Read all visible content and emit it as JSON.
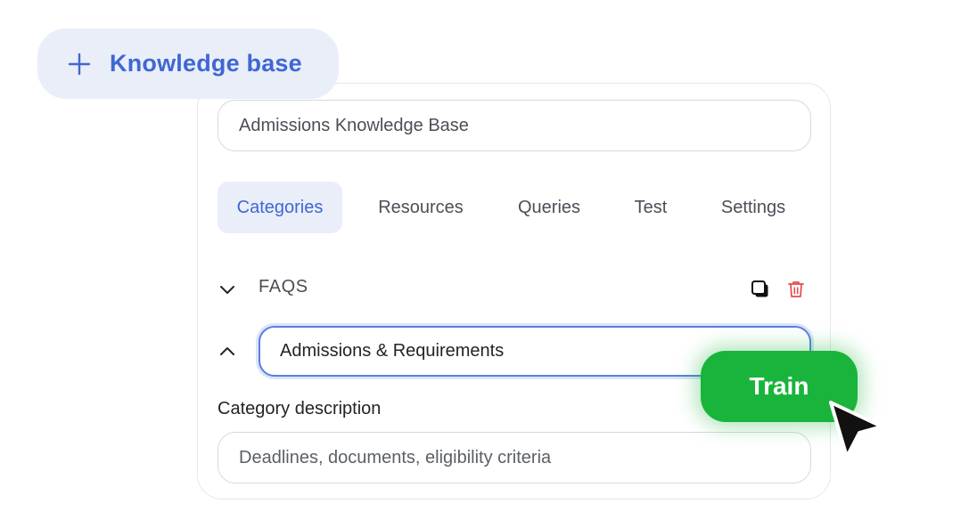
{
  "knowledge_base_button": {
    "label": "Knowledge base",
    "icon": "plus-icon"
  },
  "name_field": {
    "value": "Admissions Knowledge Base"
  },
  "tabs": [
    {
      "label": "Categories",
      "active": true
    },
    {
      "label": "Resources",
      "active": false
    },
    {
      "label": "Queries",
      "active": false
    },
    {
      "label": "Test",
      "active": false
    },
    {
      "label": "Settings",
      "active": false
    }
  ],
  "categories": [
    {
      "label": "FAQS",
      "expanded": false,
      "icons": [
        "copy-icon",
        "trash-icon"
      ]
    },
    {
      "label": "Admissions & Requirements",
      "expanded": true
    }
  ],
  "category_description": {
    "label": "Category description",
    "value": "Deadlines, documents, eligibility criteria"
  },
  "train_button": {
    "label": "Train"
  },
  "colors": {
    "accent_blue": "#3f67d4",
    "accent_blue_bg": "#e9eef9",
    "train_green": "#19b43b",
    "delete_red": "#e5484d"
  }
}
